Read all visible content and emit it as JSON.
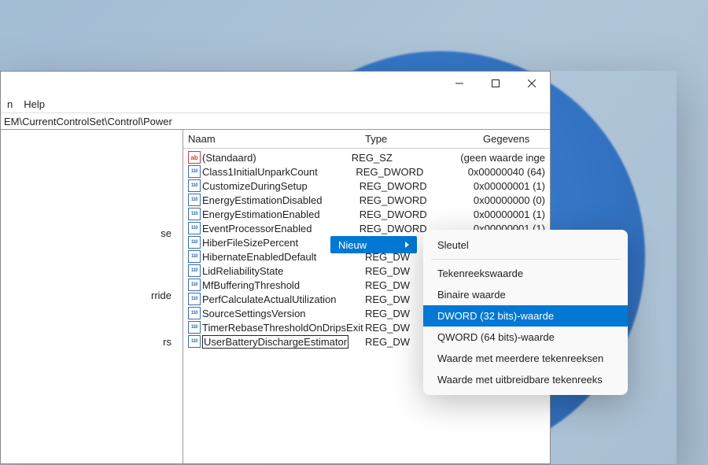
{
  "menubar": {
    "item0": "n",
    "item1": "Help"
  },
  "addressbar": {
    "path": "EM\\CurrentControlSet\\Control\\Power"
  },
  "tree": {
    "i0": "se",
    "i1": "rride",
    "i2": "rs"
  },
  "headers": {
    "name": "Naam",
    "type": "Type",
    "data": "Gegevens"
  },
  "rows": [
    {
      "icon": "sz",
      "name": "(Standaard)",
      "type": "REG_SZ",
      "data": "(geen waarde inge"
    },
    {
      "icon": "dw",
      "name": "Class1InitialUnparkCount",
      "type": "REG_DWORD",
      "data": "0x00000040 (64)"
    },
    {
      "icon": "dw",
      "name": "CustomizeDuringSetup",
      "type": "REG_DWORD",
      "data": "0x00000001 (1)"
    },
    {
      "icon": "dw",
      "name": "EnergyEstimationDisabled",
      "type": "REG_DWORD",
      "data": "0x00000000 (0)"
    },
    {
      "icon": "dw",
      "name": "EnergyEstimationEnabled",
      "type": "REG_DWORD",
      "data": "0x00000001 (1)"
    },
    {
      "icon": "dw",
      "name": "EventProcessorEnabled",
      "type": "REG_DWORD",
      "data": "0x00000001 (1)"
    },
    {
      "icon": "dw",
      "name": "HiberFileSizePercent",
      "type": "REG_DW",
      "data": ""
    },
    {
      "icon": "dw",
      "name": "HibernateEnabledDefault",
      "type": "REG_DW",
      "data": ""
    },
    {
      "icon": "dw",
      "name": "LidReliabilityState",
      "type": "REG_DW",
      "data": ""
    },
    {
      "icon": "dw",
      "name": "MfBufferingThreshold",
      "type": "REG_DW",
      "data": ""
    },
    {
      "icon": "dw",
      "name": "PerfCalculateActualUtilization",
      "type": "REG_DW",
      "data": ""
    },
    {
      "icon": "dw",
      "name": "SourceSettingsVersion",
      "type": "REG_DW",
      "data": ""
    },
    {
      "icon": "dw",
      "name": "TimerRebaseThresholdOnDripsExit",
      "type": "REG_DW",
      "data": ""
    },
    {
      "icon": "dw",
      "name": "UserBatteryDischargeEstimator",
      "type": "REG_DW",
      "data": "",
      "editing": true
    }
  ],
  "context": {
    "label": "Nieuw"
  },
  "submenu": {
    "i0": "Sleutel",
    "i1": "Tekenreekswaarde",
    "i2": "Binaire waarde",
    "i3": "DWORD (32 bits)-waarde",
    "i4": "QWORD (64 bits)-waarde",
    "i5": "Waarde met meerdere tekenreeksen",
    "i6": "Waarde met uitbreidbare tekenreeks"
  }
}
